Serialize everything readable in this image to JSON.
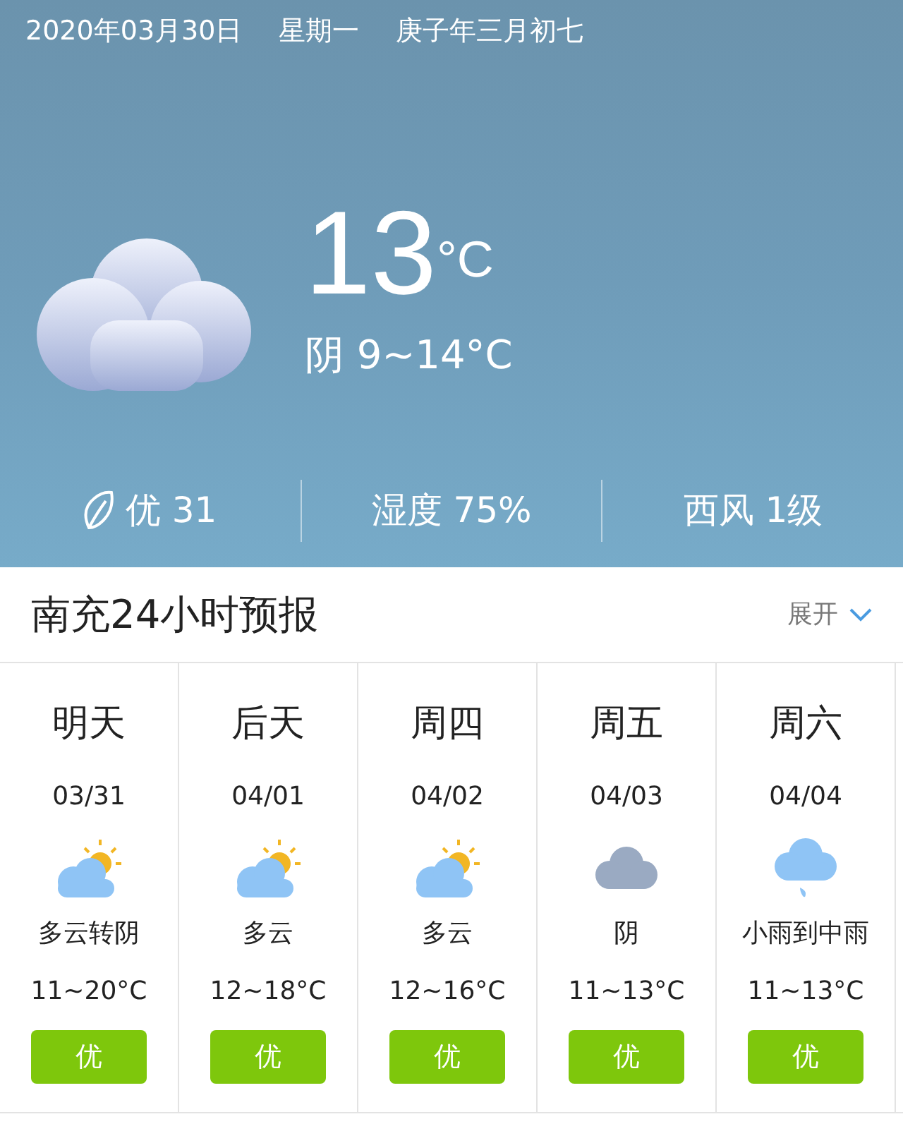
{
  "header": {
    "date": "2020年03月30日",
    "weekday": "星期一",
    "lunar": "庚子年三月初七"
  },
  "current": {
    "kind": "overcast",
    "temp": "13",
    "unit": "°C",
    "summary": "阴 9~14°C"
  },
  "stats": [
    {
      "kind": "aqi",
      "text": "优 31"
    },
    {
      "kind": "plain",
      "text": "湿度 75%"
    },
    {
      "kind": "plain",
      "text": "西风 1级"
    }
  ],
  "forecast_section": {
    "title": "南充24小时预报",
    "toggle": "展开",
    "expanded": false
  },
  "days": [
    {
      "day": "明天",
      "date": "03/31",
      "kind": "partly_cloudy",
      "weather": "多云转阴",
      "temps": "11~20°C",
      "aqi": "优"
    },
    {
      "day": "后天",
      "date": "04/01",
      "kind": "partly_cloudy",
      "weather": "多云",
      "temps": "12~18°C",
      "aqi": "优"
    },
    {
      "day": "周四",
      "date": "04/02",
      "kind": "partly_cloudy",
      "weather": "多云",
      "temps": "12~16°C",
      "aqi": "优"
    },
    {
      "day": "周五",
      "date": "04/03",
      "kind": "overcast",
      "weather": "阴",
      "temps": "11~13°C",
      "aqi": "优"
    },
    {
      "day": "周六",
      "date": "04/04",
      "kind": "rain",
      "weather": "小雨到中雨",
      "temps": "11~13°C",
      "aqi": "优"
    }
  ]
}
